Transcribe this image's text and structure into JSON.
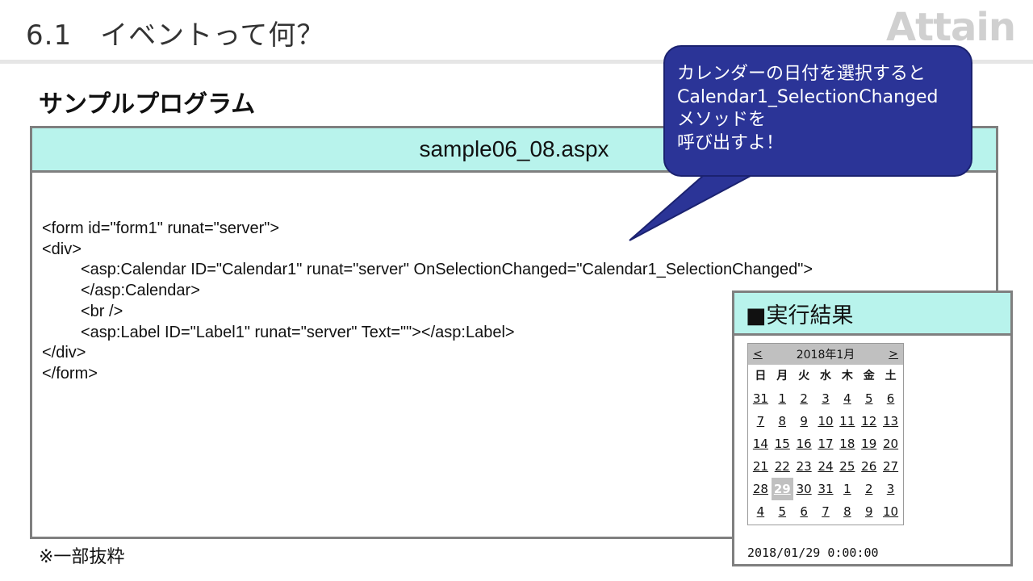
{
  "slide": {
    "title": "6.1　イベントって何？",
    "logo": "Attain"
  },
  "section": {
    "heading": "サンプルプログラム"
  },
  "code": {
    "filename": "sample06_08.aspx",
    "lines": [
      "<form id=\"form1\" runat=\"server\">",
      "<div>",
      "<asp:Calendar ID=\"Calendar1\" runat=\"server\" OnSelectionChanged=\"Calendar1_SelectionChanged\">",
      "</asp:Calendar>",
      "<br />",
      "<asp:Label ID=\"Label1\" runat=\"server\" Text=\"\"></asp:Label>",
      "</div>",
      "</form>"
    ],
    "footnote": "※一部抜粋"
  },
  "callout": {
    "lines": [
      "カレンダーの日付を選択すると",
      "Calendar1_SelectionChanged",
      "メソッドを",
      "呼び出すよ！"
    ],
    "color": "#2b3497"
  },
  "result": {
    "heading": "■実行結果",
    "calendar": {
      "prev": "<",
      "month_title": "2018年1月",
      "next": ">",
      "weekdays": [
        "日",
        "月",
        "火",
        "水",
        "木",
        "金",
        "土"
      ],
      "weeks": [
        [
          "31",
          "1",
          "2",
          "3",
          "4",
          "5",
          "6"
        ],
        [
          "7",
          "8",
          "9",
          "10",
          "11",
          "12",
          "13"
        ],
        [
          "14",
          "15",
          "16",
          "17",
          "18",
          "19",
          "20"
        ],
        [
          "21",
          "22",
          "23",
          "24",
          "25",
          "26",
          "27"
        ],
        [
          "28",
          "29",
          "30",
          "31",
          "1",
          "2",
          "3"
        ],
        [
          "4",
          "5",
          "6",
          "7",
          "8",
          "9",
          "10"
        ]
      ],
      "selected": "29"
    },
    "label_text": "2018/01/29 0:00:00"
  },
  "colors": {
    "header_fill": "#b8f3ec",
    "border": "#7f7f7f",
    "selected_day": "#c0c0c0"
  }
}
